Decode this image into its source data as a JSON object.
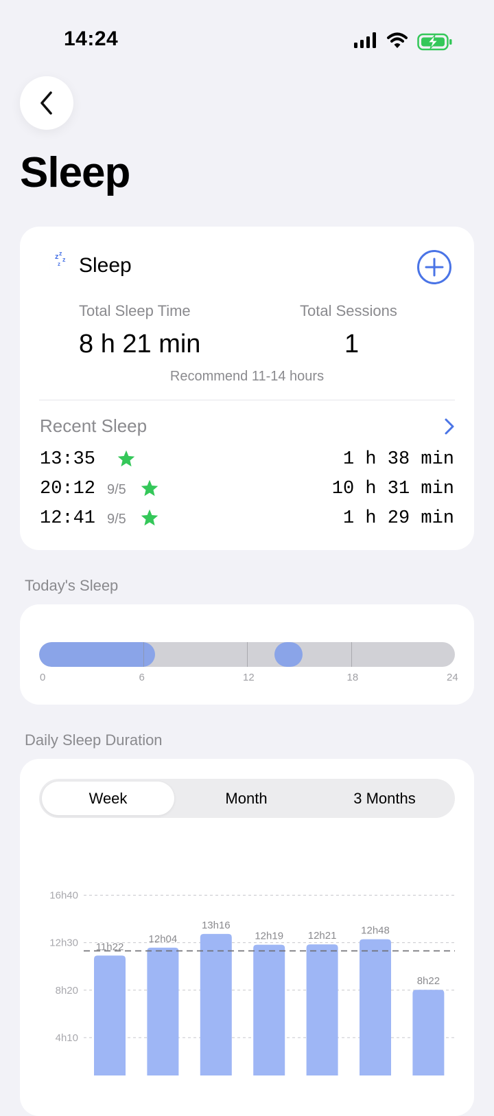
{
  "status_bar": {
    "time": "14:24"
  },
  "header": {
    "title": "Sleep"
  },
  "summary_card": {
    "title": "Sleep",
    "total_sleep_label": "Total Sleep Time",
    "total_sleep_value": "8 h 21 min",
    "total_sessions_label": "Total Sessions",
    "total_sessions_value": "1",
    "recommendation": "Recommend 11-14 hours",
    "recent_title": "Recent Sleep",
    "recent": [
      {
        "time": "13:35",
        "date": "",
        "duration": "1 h 38 min"
      },
      {
        "time": "20:12",
        "date": "9/5",
        "duration": "10 h 31 min"
      },
      {
        "time": "12:41",
        "date": "9/5",
        "duration": "1 h 29 min"
      }
    ]
  },
  "todays_sleep": {
    "label": "Today's Sleep",
    "ticks": [
      "0",
      "6",
      "12",
      "18",
      "24"
    ],
    "segments": [
      {
        "start_hour": 0,
        "end_hour": 6.7
      },
      {
        "start_hour": 13.6,
        "end_hour": 15.2
      }
    ]
  },
  "daily_duration": {
    "label": "Daily Sleep Duration",
    "tabs": [
      "Week",
      "Month",
      "3 Months"
    ],
    "active_tab": "Week"
  },
  "colors": {
    "accent": "#4a74e6",
    "bar": "#9eb6f5",
    "today_bar": "#8aa4e8",
    "star": "#34c759"
  },
  "chart_data": {
    "type": "bar",
    "categories": [
      "",
      "",
      "",
      "",
      "",
      "",
      ""
    ],
    "values": [
      682,
      724,
      796,
      739,
      741,
      768,
      502
    ],
    "data_labels": [
      "11h22",
      "12h04",
      "13h16",
      "12h19",
      "12h21",
      "12h48",
      "8h22"
    ],
    "y_ticks": [
      {
        "value": 1000,
        "label": "16h40"
      },
      {
        "value": 750,
        "label": "12h30"
      },
      {
        "value": 500,
        "label": "8h20"
      },
      {
        "value": 250,
        "label": "4h10"
      }
    ],
    "average": 707,
    "ylabel": "",
    "grid": true
  }
}
